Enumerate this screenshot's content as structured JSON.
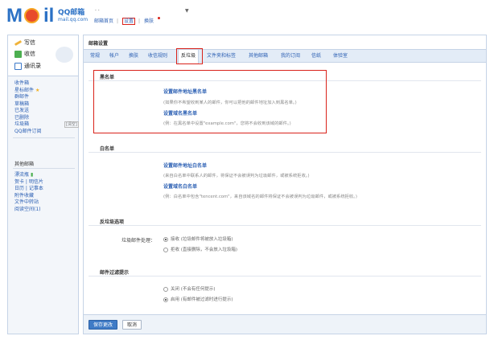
{
  "header": {
    "logo_main": "M",
    "logo_rest": "il",
    "logo_qq": "QQ邮箱",
    "logo_domain": "mail.qq.com",
    "user_name": "·  ·",
    "links": [
      "邮箱首页",
      "设置",
      "换肤"
    ]
  },
  "sidebar": {
    "write": "写信",
    "receive": "收信",
    "contacts": "通讯录",
    "folders": [
      {
        "label": "收件箱"
      },
      {
        "label": "星标邮件"
      },
      {
        "label": "群邮件"
      },
      {
        "label": "草稿箱"
      },
      {
        "label": "已发送"
      },
      {
        "label": "已删除"
      },
      {
        "label": "垃圾箱",
        "tag": "[清空]"
      },
      {
        "label": "QQ邮件订阅"
      }
    ],
    "other_heading": "其他邮箱",
    "other": [
      "漂流瓶",
      "贺卡 | 明信片",
      "日历 | 记事本",
      "附件收藏",
      "文件中转站",
      "阅读空间(1)"
    ]
  },
  "main": {
    "title": "邮箱设置",
    "tabs": [
      "常规",
      "帐户",
      "换肤",
      "收信规则",
      "反垃圾",
      "文件夹和标签",
      "其他邮箱",
      "我的订阅",
      "信纸",
      "体验室"
    ],
    "active_tab": "反垃圾",
    "blacklist": {
      "heading": "黑名单",
      "addr_title": "设置邮件地址黑名单",
      "addr_desc": "(如果你不希望收到某人的邮件，你可以把他的邮件地址加入到黑名单。)",
      "domain_title": "设置域名黑名单",
      "domain_desc": "(例：在黑名单中设置\"example.com\"，您将不会收到该域的邮件。)"
    },
    "whitelist": {
      "heading": "白名单",
      "addr_title": "设置邮件地址白名单",
      "addr_desc": "(来自白名单中联系人的邮件，将保证不会被误判为垃圾邮件，或被系统拒收。)",
      "domain_title": "设置域名白名单",
      "domain_desc": "(例：白名单中包含\"tencent.com\"，来自该域名的邮件将保证不会被误判为垃圾邮件，或被系统拒收。)"
    },
    "antispam": {
      "heading": "反垃圾选项",
      "label": "垃圾邮件处理：",
      "options": [
        "接收 (垃圾邮件将被放入垃圾箱)",
        "拒收 (直接删除，不会放入垃圾箱)"
      ],
      "selected": 0
    },
    "notify": {
      "heading": "邮件过滤提示",
      "options": [
        "关闭 (不会有任何提示)",
        "启用 (有邮件被过滤时进行提示)"
      ],
      "selected": 1
    },
    "buttons": {
      "save": "保存更改",
      "cancel": "取消"
    }
  },
  "colors": {
    "accent": "#2b71c5",
    "link": "#2b5fb3",
    "highlight_red": "#d9221a",
    "tab_bar": "#e3ecf7"
  }
}
